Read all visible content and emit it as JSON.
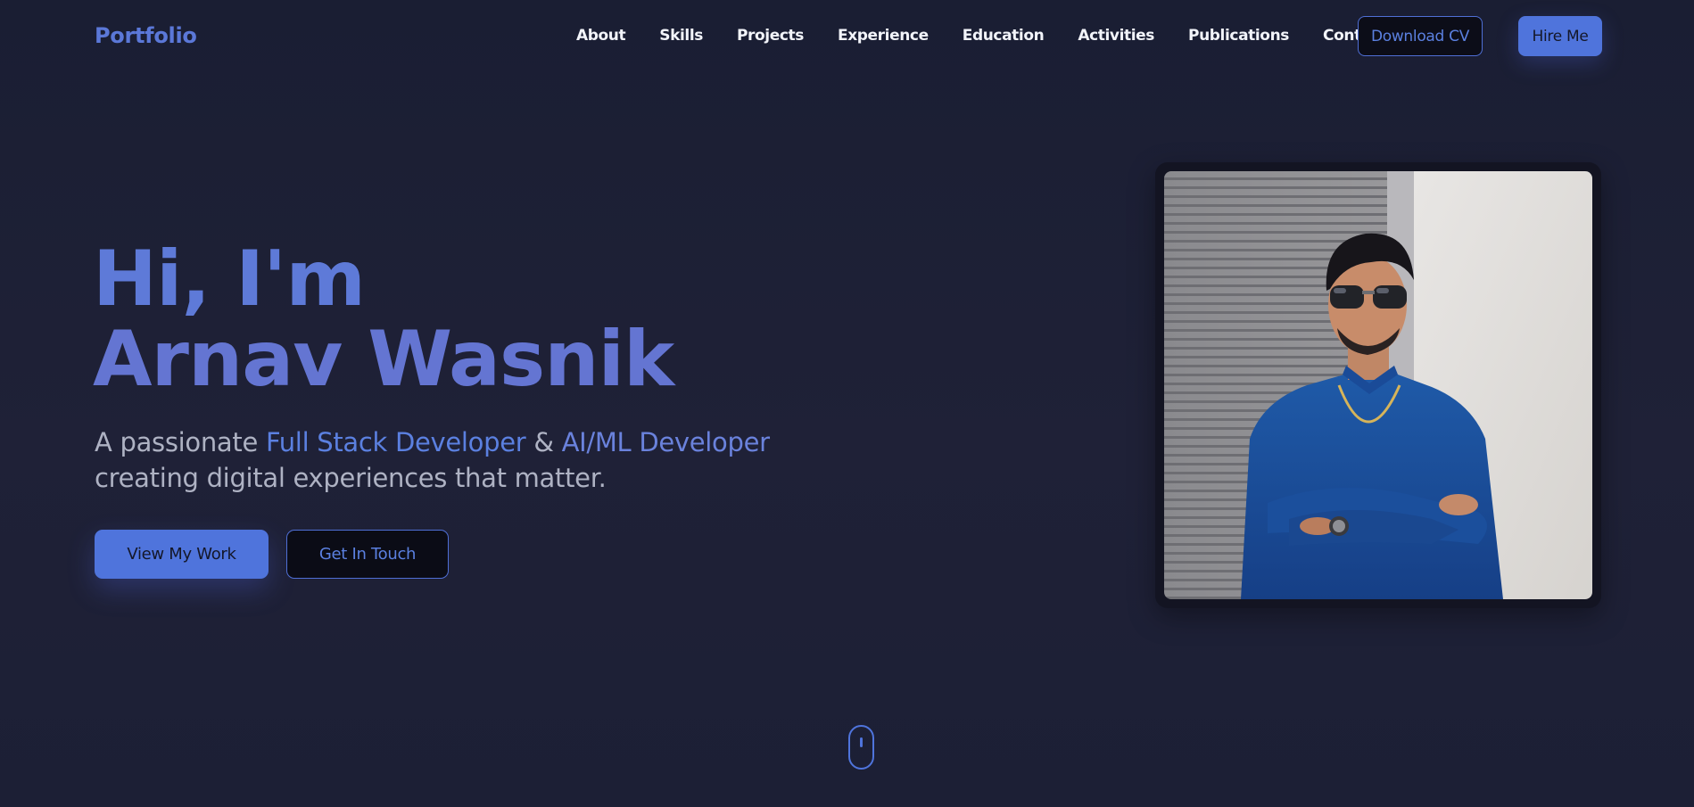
{
  "nav": {
    "brand": "Portfolio",
    "links": [
      "About",
      "Skills",
      "Projects",
      "Experience",
      "Education",
      "Activities",
      "Publications",
      "Contact"
    ],
    "download_cv": "Download CV",
    "hire_me": "Hire Me"
  },
  "hero": {
    "greeting": "Hi, I'm",
    "name": "Arnav Wasnik",
    "sub_prefix": "A passionate ",
    "role_1": "Full Stack Developer",
    "sub_amp": " & ",
    "role_2": "AI/ML Developer",
    "sub_suffix": " creating digital experiences that matter.",
    "primary_cta": "View My Work",
    "secondary_cta": "Get In Touch"
  },
  "photo": {
    "icon": "portrait-photo"
  },
  "scroll": {
    "icon": "mouse-scroll-icon"
  },
  "colors": {
    "accent": "#4f74dc",
    "accent_text": "#5b80e0",
    "background": "#1f2137"
  }
}
